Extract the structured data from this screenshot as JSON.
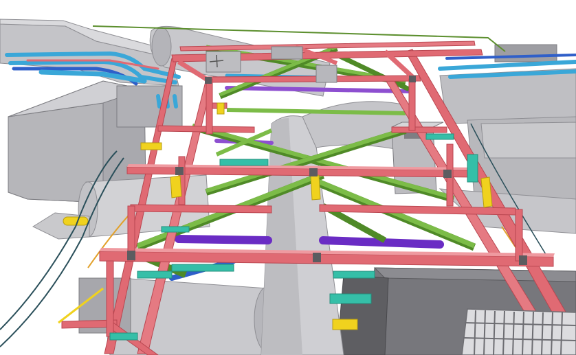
{
  "scene": {
    "kind": "3d-bim-model-render",
    "colors": {
      "background": "#ffffff",
      "duct_gray": "#b9b9bd",
      "duct_light": "#d9d9dc",
      "duct_dark": "#8e8e93",
      "beam_red": "#e06a73",
      "beam_red_dark": "#b94650",
      "brace_green": "#6fae3f",
      "brace_green_dark": "#4f8a27",
      "teal": "#35bfa8",
      "cyan_pipe": "#3aa7d8",
      "blue_pipe": "#2f5fc9",
      "purple": "#8d4fd0",
      "violet": "#6a2cc4",
      "yellow": "#f0d21e",
      "dark_block": "#5f5f63",
      "cable_line": "#2a4f5a",
      "orange_line": "#e2a12b"
    }
  }
}
